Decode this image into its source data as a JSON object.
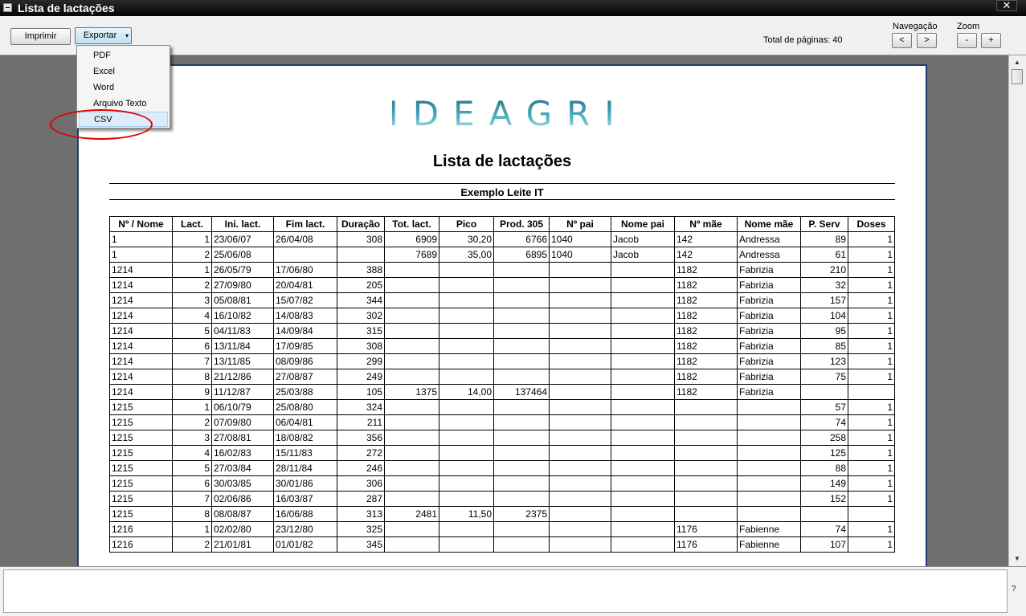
{
  "window": {
    "title": "Lista de lactações",
    "close_glyph": "✕"
  },
  "toolbar": {
    "print_label": "Imprimir",
    "export_label": "Exportar",
    "total_pages": "Total de páginas: 40",
    "navigation_label": "Navegação",
    "nav_prev": "<",
    "nav_next": ">",
    "zoom_label": "Zoom",
    "zoom_out": "-",
    "zoom_in": "+"
  },
  "export_menu": [
    "PDF",
    "Excel",
    "Word",
    "Arquivo Texto",
    "CSV"
  ],
  "report": {
    "logo_text": "IDEAGRI",
    "title": "Lista de lactações",
    "subtitle": "Exemplo Leite IT",
    "columns": [
      "Nº / Nome",
      "Lact.",
      "Ini. lact.",
      "Fim lact.",
      "Duração",
      "Tot. lact.",
      "Pico",
      "Prod. 305",
      "Nº pai",
      "Nome pai",
      "Nº mãe",
      "Nome mãe",
      "P. Serv",
      "Doses"
    ],
    "rows": [
      [
        "1",
        "1",
        "23/06/07",
        "26/04/08",
        "308",
        "6909",
        "30,20",
        "6766",
        "1040",
        "Jacob",
        "142",
        "Andressa",
        "89",
        "1"
      ],
      [
        "1",
        "2",
        "25/06/08",
        "",
        "",
        "7689",
        "35,00",
        "6895",
        "1040",
        "Jacob",
        "142",
        "Andressa",
        "61",
        "1"
      ],
      [
        "1214",
        "1",
        "26/05/79",
        "17/06/80",
        "388",
        "",
        "",
        "",
        "",
        "",
        "1182",
        "Fabrizia",
        "210",
        "1"
      ],
      [
        "1214",
        "2",
        "27/09/80",
        "20/04/81",
        "205",
        "",
        "",
        "",
        "",
        "",
        "1182",
        "Fabrizia",
        "32",
        "1"
      ],
      [
        "1214",
        "3",
        "05/08/81",
        "15/07/82",
        "344",
        "",
        "",
        "",
        "",
        "",
        "1182",
        "Fabrizia",
        "157",
        "1"
      ],
      [
        "1214",
        "4",
        "16/10/82",
        "14/08/83",
        "302",
        "",
        "",
        "",
        "",
        "",
        "1182",
        "Fabrizia",
        "104",
        "1"
      ],
      [
        "1214",
        "5",
        "04/11/83",
        "14/09/84",
        "315",
        "",
        "",
        "",
        "",
        "",
        "1182",
        "Fabrizia",
        "95",
        "1"
      ],
      [
        "1214",
        "6",
        "13/11/84",
        "17/09/85",
        "308",
        "",
        "",
        "",
        "",
        "",
        "1182",
        "Fabrizia",
        "85",
        "1"
      ],
      [
        "1214",
        "7",
        "13/11/85",
        "08/09/86",
        "299",
        "",
        "",
        "",
        "",
        "",
        "1182",
        "Fabrizia",
        "123",
        "1"
      ],
      [
        "1214",
        "8",
        "21/12/86",
        "27/08/87",
        "249",
        "",
        "",
        "",
        "",
        "",
        "1182",
        "Fabrizia",
        "75",
        "1"
      ],
      [
        "1214",
        "9",
        "11/12/87",
        "25/03/88",
        "105",
        "1375",
        "14,00",
        "137464",
        "",
        "",
        "1182",
        "Fabrizia",
        "",
        ""
      ],
      [
        "1215",
        "1",
        "06/10/79",
        "25/08/80",
        "324",
        "",
        "",
        "",
        "",
        "",
        "",
        "",
        "57",
        "1"
      ],
      [
        "1215",
        "2",
        "07/09/80",
        "06/04/81",
        "211",
        "",
        "",
        "",
        "",
        "",
        "",
        "",
        "74",
        "1"
      ],
      [
        "1215",
        "3",
        "27/08/81",
        "18/08/82",
        "356",
        "",
        "",
        "",
        "",
        "",
        "",
        "",
        "258",
        "1"
      ],
      [
        "1215",
        "4",
        "16/02/83",
        "15/11/83",
        "272",
        "",
        "",
        "",
        "",
        "",
        "",
        "",
        "125",
        "1"
      ],
      [
        "1215",
        "5",
        "27/03/84",
        "28/11/84",
        "246",
        "",
        "",
        "",
        "",
        "",
        "",
        "",
        "88",
        "1"
      ],
      [
        "1215",
        "6",
        "30/03/85",
        "30/01/86",
        "306",
        "",
        "",
        "",
        "",
        "",
        "",
        "",
        "149",
        "1"
      ],
      [
        "1215",
        "7",
        "02/06/86",
        "16/03/87",
        "287",
        "",
        "",
        "",
        "",
        "",
        "",
        "",
        "152",
        "1"
      ],
      [
        "1215",
        "8",
        "08/08/87",
        "16/06/88",
        "313",
        "2481",
        "11,50",
        "2375",
        "",
        "",
        "",
        "",
        "",
        ""
      ],
      [
        "1216",
        "1",
        "02/02/80",
        "23/12/80",
        "325",
        "",
        "",
        "",
        "",
        "",
        "1176",
        "Fabienne",
        "74",
        "1"
      ],
      [
        "1216",
        "2",
        "21/01/81",
        "01/01/82",
        "345",
        "",
        "",
        "",
        "",
        "",
        "1176",
        "Fabienne",
        "107",
        "1"
      ]
    ]
  },
  "bottom": {
    "help_glyph": "?"
  },
  "colors": {
    "accent_blue": "#233a6e",
    "highlight": "#dcecf8",
    "annotation_red": "#e00000",
    "logo_teal": "#2f8c9c"
  }
}
